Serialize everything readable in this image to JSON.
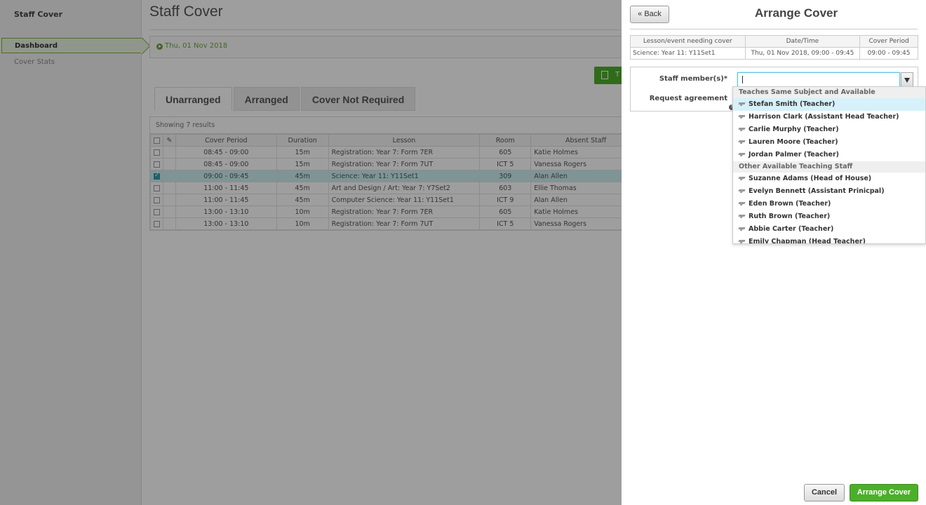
{
  "sidebar": {
    "app_title": "Staff Cover",
    "items": [
      {
        "label": "Dashboard"
      },
      {
        "label": "Cover Stats"
      }
    ]
  },
  "main": {
    "title": "Staff Cover",
    "date": "Thu, 01 Nov 2018",
    "pdf_label": "T",
    "tabs": [
      {
        "label": "Unarranged"
      },
      {
        "label": "Arranged"
      },
      {
        "label": "Cover Not Required"
      }
    ],
    "results_text": "Showing 7 results",
    "columns": [
      "Cover Period",
      "Duration",
      "Lesson",
      "Room",
      "Absent Staff"
    ],
    "rows": [
      {
        "period": "08:45 - 09:00",
        "duration": "15m",
        "lesson": "Registration: Year 7: Form 7ER",
        "room": "605",
        "staff": "Katie Holmes"
      },
      {
        "period": "08:45 - 09:00",
        "duration": "15m",
        "lesson": "Registration: Year 7: Form 7UT",
        "room": "ICT 5",
        "staff": "Vanessa Rogers"
      },
      {
        "period": "09:00 - 09:45",
        "duration": "45m",
        "lesson": "Science: Year 11: Y11Set1",
        "room": "309",
        "staff": "Alan Allen"
      },
      {
        "period": "11:00 - 11:45",
        "duration": "45m",
        "lesson": "Art and Design / Art: Year 7: Y7Set2",
        "room": "603",
        "staff": "Ellie Thomas"
      },
      {
        "period": "11:00 - 11:45",
        "duration": "45m",
        "lesson": "Computer Science: Year 11: Y11Set1",
        "room": "ICT 9",
        "staff": "Alan Allen"
      },
      {
        "period": "13:00 - 13:10",
        "duration": "10m",
        "lesson": "Registration: Year 7: Form 7ER",
        "room": "605",
        "staff": "Katie Holmes"
      },
      {
        "period": "13:00 - 13:10",
        "duration": "10m",
        "lesson": "Registration: Year 7: Form 7UT",
        "room": "ICT 5",
        "staff": "Vanessa Rogers"
      }
    ]
  },
  "panel": {
    "back_label": "« Back",
    "title": "Arrange Cover",
    "info_headers": [
      "Lesson/event needing cover",
      "Date/Time",
      "Cover Period"
    ],
    "info_row": [
      "Science: Year 11: Y11Set1",
      "Thu, 01 Nov 2018, 09:00 - 09:45",
      "09:00 - 09:45"
    ],
    "staff_label": "Staff member(s)*",
    "agreement_label": "Request agreement",
    "staff_value": "",
    "cancel_label": "Cancel",
    "arrange_label": "Arrange Cover"
  },
  "dropdown": {
    "groups": [
      {
        "heading": "Teaches Same Subject and Available",
        "options": [
          "Stefan Smith (Teacher)",
          "Harrison Clark (Assistant Head Teacher)",
          "Carlie Murphy (Teacher)",
          "Lauren Moore (Teacher)",
          "Jordan Palmer (Teacher)"
        ]
      },
      {
        "heading": "Other Available Teaching Staff",
        "options": [
          "Suzanne Adams (Head of House)",
          "Evelyn Bennett (Assistant Prinicpal)",
          "Eden Brown (Teacher)",
          "Ruth Brown (Teacher)",
          "Abbie Carter (Teacher)",
          "Emily Chapman (Head Teacher)"
        ]
      }
    ]
  }
}
